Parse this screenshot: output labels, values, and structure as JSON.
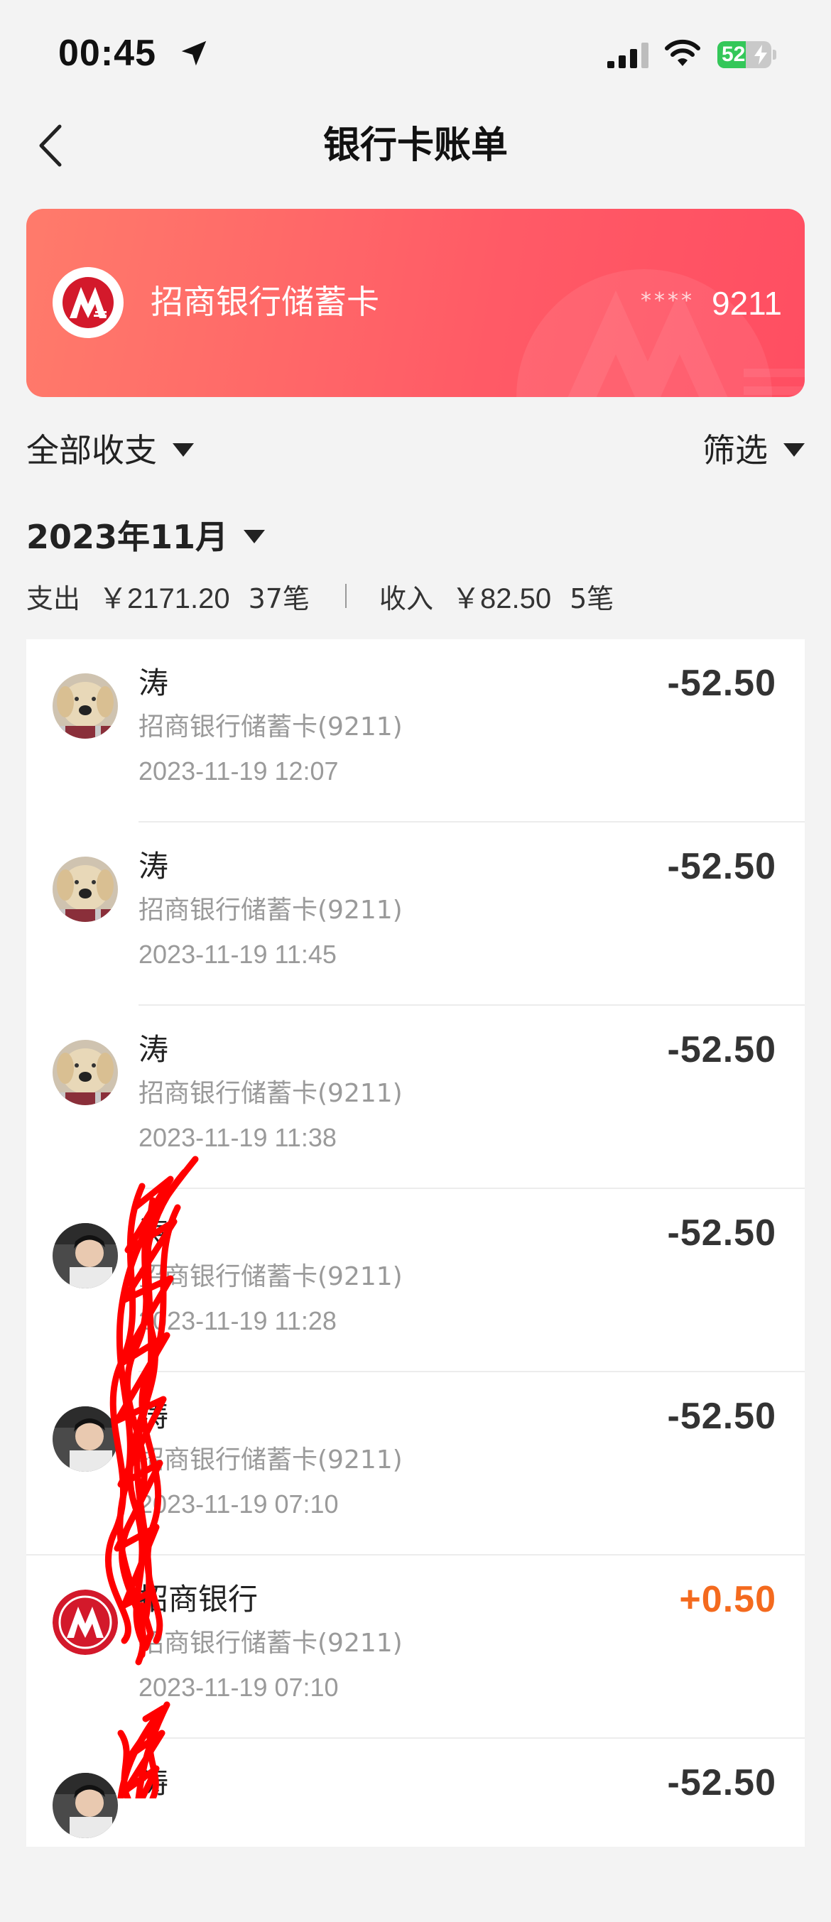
{
  "status_bar": {
    "time": "00:45",
    "battery_level": "52",
    "battery_fraction": 0.52,
    "icons": [
      "location-arrow-icon",
      "cellular-signal-icon",
      "wifi-icon",
      "battery-charging-icon"
    ]
  },
  "nav": {
    "title": "银行卡账单",
    "back_icon": "chevron-left-icon"
  },
  "card": {
    "bank_name": "招商银行储蓄卡",
    "masked_digits": "****",
    "last4": "9211",
    "colors": {
      "gradient_start": "#ff7b6b",
      "gradient_end": "#ff4e62",
      "logo_red": "#d3192b"
    }
  },
  "filters": {
    "type_label": "全部收支",
    "filter_label": "筛选"
  },
  "period": {
    "month_label": "2023年11月"
  },
  "summary": {
    "expense_label": "支出",
    "expense_amount": "￥2171.20",
    "expense_count": "37笔",
    "income_label": "收入",
    "income_amount": "￥82.50",
    "income_count": "5笔"
  },
  "transactions": [
    {
      "name": "涛",
      "card": "招商银行储蓄卡(9211)",
      "time": "2023-11-19 12:07",
      "amount": "-52.50",
      "avatar": "dog-avatar"
    },
    {
      "name": "涛",
      "card": "招商银行储蓄卡(9211)",
      "time": "2023-11-19 11:45",
      "amount": "-52.50",
      "avatar": "dog-avatar"
    },
    {
      "name": "涛",
      "card": "招商银行储蓄卡(9211)",
      "time": "2023-11-19 11:38",
      "amount": "-52.50",
      "avatar": "dog-avatar"
    },
    {
      "name": "涛",
      "card": "招商银行储蓄卡(9211)",
      "time": "2023-11-19 11:28",
      "amount": "-52.50",
      "avatar": "person-avatar"
    },
    {
      "name": "涛",
      "card": "招商银行储蓄卡(9211)",
      "time": "2023-11-19 07:10",
      "amount": "-52.50",
      "avatar": "person-avatar"
    },
    {
      "name": "招商银行",
      "card": "招商银行储蓄卡(9211)",
      "time": "2023-11-19 07:10",
      "amount": "+0.50",
      "avatar": "bank-logo"
    },
    {
      "name": "涛",
      "card": "",
      "time": "",
      "amount": "-52.50",
      "avatar": "person-avatar"
    }
  ],
  "colors": {
    "income_amount": "#f46a1e",
    "expense_amount": "#333333",
    "redaction": "#ff0000"
  }
}
